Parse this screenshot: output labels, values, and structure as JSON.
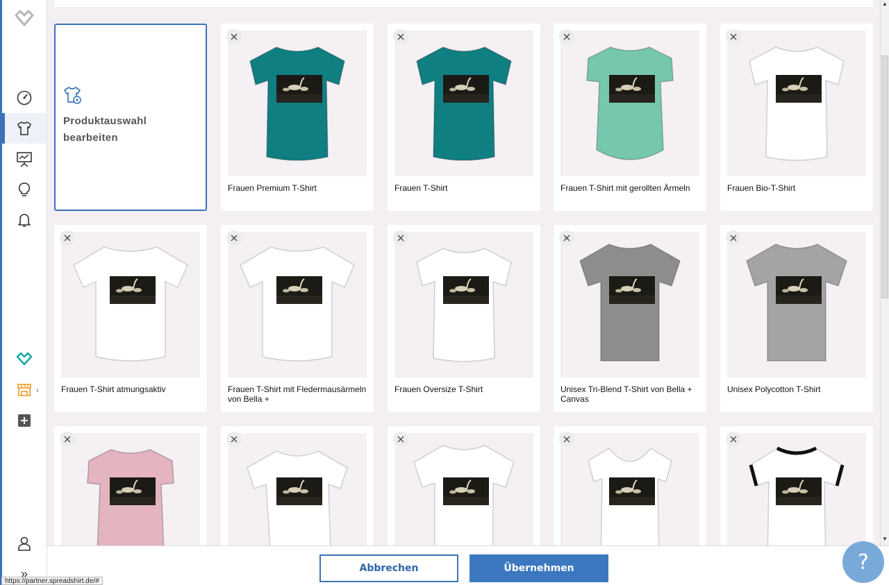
{
  "sidebar": {
    "items": [
      {
        "icon": "logo-diamond-icon"
      },
      {
        "icon": "dashboard-gauge-icon"
      },
      {
        "icon": "tshirt-icon",
        "active": true
      },
      {
        "icon": "presentation-chart-icon"
      },
      {
        "icon": "lightbulb-icon"
      },
      {
        "icon": "bell-icon"
      },
      {
        "icon": "spreadshop-diamond-icon"
      },
      {
        "icon": "shop-store-icon"
      },
      {
        "icon": "add-square-icon"
      },
      {
        "icon": "user-icon"
      },
      {
        "icon": "expand-double-chevron-icon"
      }
    ],
    "shop_chevron": "›",
    "expand_glyph": "»"
  },
  "edit_card": {
    "label": "Produktauswahl bearbeiten"
  },
  "products": [
    {
      "name": "Frauen Premium T-Shirt",
      "color": "#0f7f82",
      "style": "fitted"
    },
    {
      "name": "Frauen T-Shirt",
      "color": "#0f7f82",
      "style": "fitted"
    },
    {
      "name": "Frauen T-Shirt mit gerollten Ärmeln",
      "color": "#77c7ae",
      "style": "rolled"
    },
    {
      "name": "Frauen Bio-T-Shirt",
      "color": "#ffffff",
      "style": "fitted"
    },
    {
      "name": "Frauen T-Shirt atmungsaktiv",
      "color": "#ffffff",
      "style": "loose"
    },
    {
      "name": "Frauen T-Shirt mit Fledermausärmeln von Bella +",
      "color": "#ffffff",
      "style": "loose"
    },
    {
      "name": "Frauen Oversize T-Shirt",
      "color": "#ffffff",
      "style": "fitted"
    },
    {
      "name": "Unisex Tri-Blend T-Shirt von Bella + Canvas",
      "color": "#8d8d8d",
      "style": "unisex"
    },
    {
      "name": "Unisex Polycotton T-Shirt",
      "color": "#a4a4a4",
      "style": "unisex"
    },
    {
      "name": "",
      "color": "#e4b5c0",
      "style": "rolled"
    },
    {
      "name": "",
      "color": "#ffffff",
      "style": "knot"
    },
    {
      "name": "",
      "color": "#ffffff",
      "style": "unisex"
    },
    {
      "name": "",
      "color": "#ffffff",
      "style": "scoop"
    },
    {
      "name": "",
      "color": "#ffffff",
      "style": "ringer"
    }
  ],
  "footer": {
    "cancel_label": "Abbrechen",
    "apply_label": "Übernehmen"
  },
  "help": {
    "label": "?"
  },
  "status_url": "https://partner.spreadshirt.de/#",
  "colors": {
    "accent": "#3b73b8",
    "teal": "#1aa8a8",
    "orange": "#f0a23a"
  }
}
